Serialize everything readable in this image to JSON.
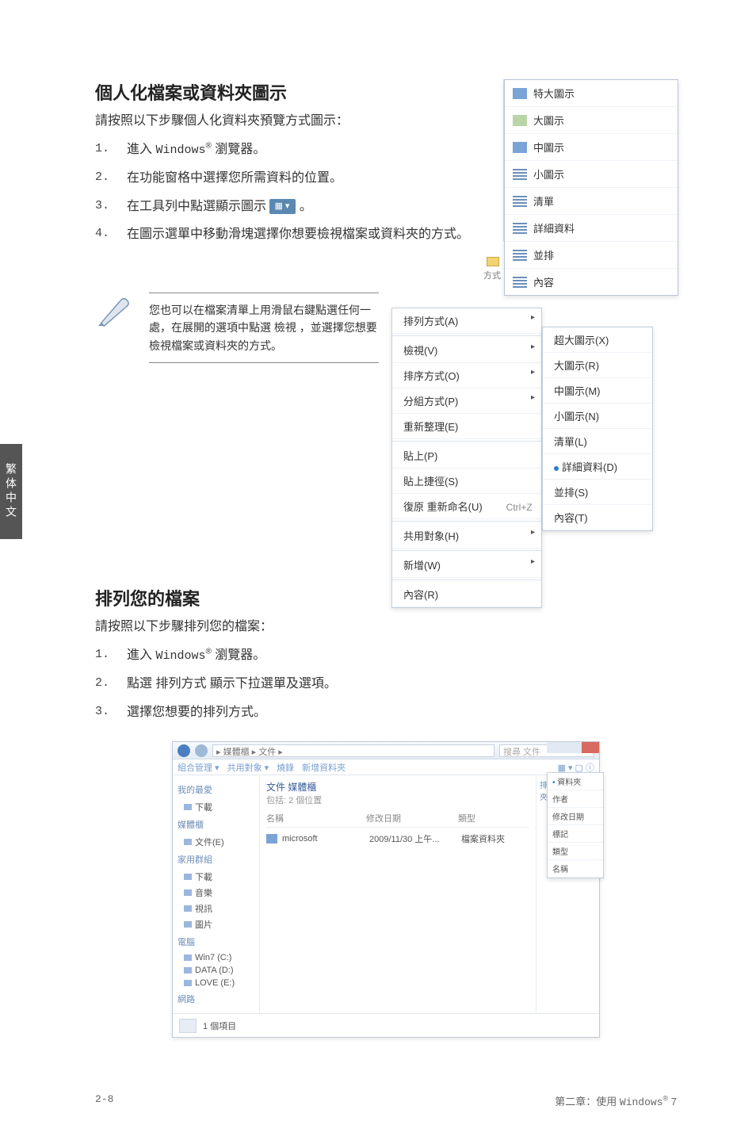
{
  "side_tab": "繁体中文",
  "section1": {
    "title": "個人化檔案或資料夾圖示",
    "sub": "請按照以下步驟個人化資料夾預覽方式圖示：",
    "steps": [
      {
        "n": "1.",
        "pre": "進入 ",
        "mono": "Windows",
        "sup": "®",
        "post": " 瀏覽器。"
      },
      {
        "n": "2.",
        "text": "在功能窗格中選擇您所需資料的位置。"
      },
      {
        "n": "3.",
        "text_a": "在工具列中點選顯示圖示 ",
        "chip": "▦ ▾",
        "text_b": "。"
      },
      {
        "n": "4.",
        "text": "在圖示選單中移動滑塊選擇你想要檢視檔案或資料夾的方式。"
      }
    ]
  },
  "view_dd": {
    "items": [
      "特大圖示",
      "大圖示",
      "中圖示",
      "小圖示",
      "清單",
      "詳細資料",
      "並排",
      "內容"
    ]
  },
  "gutter": {
    "label": "方式",
    "folder": ""
  },
  "note": "您也可以在檔案清單上用滑鼠右鍵點選任何一處，在展開的選項中點選 檢視 ，並選擇您想要檢視檔案或資料夾的方式。",
  "ctx_left": [
    {
      "label": "排列方式(A)",
      "more": true
    },
    {
      "sep": true
    },
    {
      "label": "檢視(V)",
      "more": true
    },
    {
      "label": "排序方式(O)",
      "more": true
    },
    {
      "label": "分組方式(P)",
      "more": true
    },
    {
      "label": "重新整理(E)"
    },
    {
      "sep": true
    },
    {
      "label": "貼上(P)"
    },
    {
      "label": "貼上捷徑(S)"
    },
    {
      "label": "復原 重新命名(U)",
      "suffix": "Ctrl+Z"
    },
    {
      "sep": true
    },
    {
      "label": "共用對象(H)",
      "more": true
    },
    {
      "sep": true
    },
    {
      "label": "新增(W)",
      "more": true
    },
    {
      "sep": true
    },
    {
      "label": "內容(R)"
    }
  ],
  "ctx_right": [
    {
      "label": "超大圖示(X)"
    },
    {
      "label": "大圖示(R)"
    },
    {
      "label": "中圖示(M)"
    },
    {
      "label": "小圖示(N)"
    },
    {
      "label": "清單(L)"
    },
    {
      "label": "詳細資料(D)",
      "dot": true
    },
    {
      "label": "並排(S)"
    },
    {
      "label": "內容(T)"
    }
  ],
  "section2": {
    "title": "排列您的檔案",
    "sub": "請按照以下步驟排列您的檔案：",
    "steps": [
      {
        "n": "1.",
        "pre": "進入 ",
        "mono": "Windows",
        "sup": "®",
        "post": " 瀏覽器。"
      },
      {
        "n": "2.",
        "text": "點選 排列方式 顯示下拉選單及選項。",
        "bold_frag": "排列方式"
      },
      {
        "n": "3.",
        "text": "選擇您想要的排列方式。"
      }
    ]
  },
  "explorer": {
    "addr": "▸ 媒體櫃 ▸ 文件 ▸",
    "search": "搜尋 文件",
    "toolbar_left": [
      "組合管理 ▾",
      "共用對象 ▾",
      "燒錄",
      "新增資料夾"
    ],
    "toolbar_right": "▦ ▾  ▢  ⓘ",
    "side_groups": [
      {
        "title": "我的最愛",
        "items": [
          "下載"
        ]
      },
      {
        "title": "媒體櫃",
        "items": [
          "文件(E)"
        ]
      },
      {
        "title": "家用群組",
        "items": [
          "下載",
          "音樂",
          "視訊",
          "圖片"
        ]
      },
      {
        "title": "電腦",
        "items": [
          "Win7 (C:)",
          "DATA (D:)",
          "LOVE (E:)"
        ]
      },
      {
        "title": "網路",
        "items": []
      }
    ],
    "main_header": "文件 媒體櫃",
    "main_sub": "包括: 2 個位置",
    "col_headers": [
      "名稱",
      "修改日期",
      "類型"
    ],
    "files": [
      {
        "name": "microsoft",
        "date": "2009/11/30 上午...",
        "type": "檔案資料夾"
      }
    ],
    "right_label": "排列方式: 資料夾 ▾",
    "right_menu": [
      "資料夾",
      "作者",
      "修改日期",
      "標記",
      "類型",
      "名稱"
    ],
    "status": "1 個項目"
  },
  "footer": {
    "left": "2-8",
    "right_a": "第二章：使用 ",
    "right_mono": "Windows",
    "right_sup": "®",
    "right_b": " 7"
  }
}
